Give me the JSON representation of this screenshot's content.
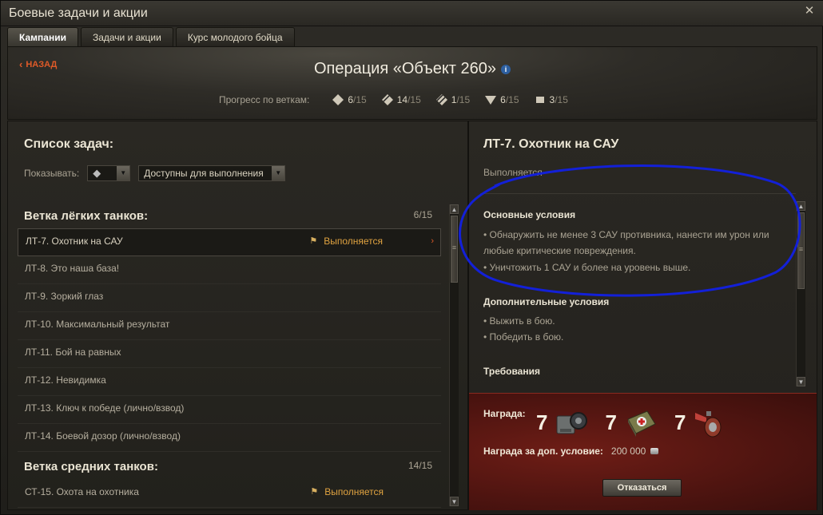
{
  "window": {
    "title": "Боевые задачи и акции",
    "close_glyph": "✕"
  },
  "tabs": [
    "Кампании",
    "Задачи и акции",
    "Курс молодого бойца"
  ],
  "hero": {
    "back_label": "НАЗАД",
    "operation_title": "Операция «Объект 260»",
    "progress_label": "Прогресс по веткам:",
    "branches": [
      {
        "icon": "light-tank-icon",
        "current": "6",
        "total": "/15"
      },
      {
        "icon": "medium-tank-icon",
        "current": "14",
        "total": "/15"
      },
      {
        "icon": "heavy-tank-icon",
        "current": "1",
        "total": "/15"
      },
      {
        "icon": "tank-destroyer-icon",
        "current": "6",
        "total": "/15"
      },
      {
        "icon": "spg-icon",
        "current": "3",
        "total": "/15"
      }
    ]
  },
  "left": {
    "heading": "Список задач:",
    "filter_label": "Показывать:",
    "filter_value": "Доступны для выполнения",
    "light_branch": {
      "title": "Ветка лёгких танков:",
      "count": "6/15"
    },
    "light_tasks": [
      {
        "name": "ЛТ-7. Охотник на САУ",
        "status": "Выполняется"
      },
      {
        "name": "ЛТ-8. Это наша база!",
        "status": ""
      },
      {
        "name": "ЛТ-9. Зоркий глаз",
        "status": ""
      },
      {
        "name": "ЛТ-10. Максимальный результат",
        "status": ""
      },
      {
        "name": "ЛТ-11. Бой на равных",
        "status": ""
      },
      {
        "name": "ЛТ-12. Невидимка",
        "status": ""
      },
      {
        "name": "ЛТ-13. Ключ к победе (лично/взвод)",
        "status": ""
      },
      {
        "name": "ЛТ-14. Боевой дозор (лично/взвод)",
        "status": ""
      }
    ],
    "medium_branch": {
      "title": "Ветка средних танков:",
      "count": "14/15"
    },
    "medium_tasks": [
      {
        "name": "СТ-15. Охота на охотника",
        "status": "Выполняется"
      }
    ]
  },
  "right": {
    "task_title": "ЛТ-7. Охотник на САУ",
    "task_state": "Выполняется",
    "main_title": "Основные условия",
    "main_conditions": [
      "• Обнаружить не менее 3 САУ противника, нанести им урон или любые критические повреждения.",
      "• Уничтожить 1 САУ и более на уровень выше."
    ],
    "extra_title": "Дополнительные условия",
    "extra_conditions": [
      "• Выжить в бою.",
      "• Победить в бою."
    ],
    "req_title": "Требования",
    "reward": {
      "label": "Награда:",
      "items": [
        {
          "count": "7",
          "icon": "repair-kit-icon"
        },
        {
          "count": "7",
          "icon": "first-aid-kit-icon"
        },
        {
          "count": "7",
          "icon": "fire-extinguisher-icon"
        }
      ],
      "extra_label": "Награда за доп. условие:",
      "extra_value": "200 000"
    },
    "decline_label": "Отказаться"
  }
}
